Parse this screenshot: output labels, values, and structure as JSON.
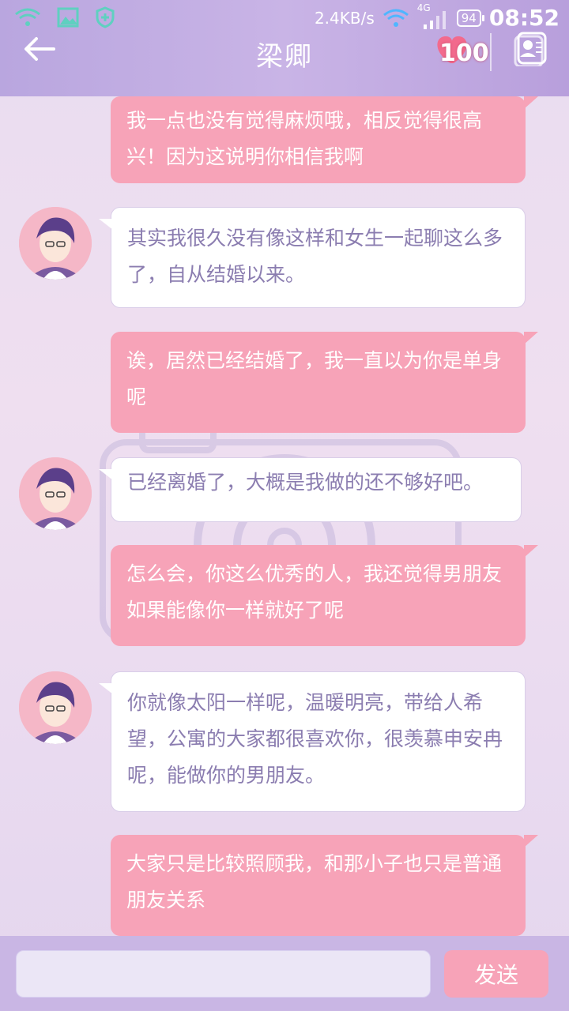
{
  "status_bar": {
    "net_speed": "2.4KB/s",
    "network_type": "4G",
    "battery": "94",
    "time": "08:52"
  },
  "header": {
    "title": "梁卿",
    "affection_count": "100"
  },
  "messages": [
    {
      "side": "out",
      "text": "我一点也没有觉得麻烦哦，相反觉得很高兴！因为这说明你相信我啊"
    },
    {
      "side": "in",
      "text": "其实我很久没有像这样和女生一起聊这么多了，自从结婚以来。"
    },
    {
      "side": "out",
      "text": "诶，居然已经结婚了，我一直以为你是单身呢"
    },
    {
      "side": "in",
      "text": "已经离婚了，大概是我做的还不够好吧。"
    },
    {
      "side": "out",
      "text": "怎么会，你这么优秀的人，我还觉得男朋友如果能像你一样就好了呢"
    },
    {
      "side": "in",
      "text": "你就像太阳一样呢，温暖明亮，带给人希望，公寓的大家都很喜欢你，很羡慕申安冉呢，能做你的男朋友。"
    },
    {
      "side": "out",
      "text": "大家只是比较照顾我，和那小子也只是普通朋友关系"
    }
  ],
  "input_bar": {
    "input_value": "",
    "send_label": "发送"
  },
  "colors": {
    "header_bg": "#c0aee2",
    "outgoing_bubble": "#f7a3b8",
    "incoming_text": "#8b7db0"
  }
}
